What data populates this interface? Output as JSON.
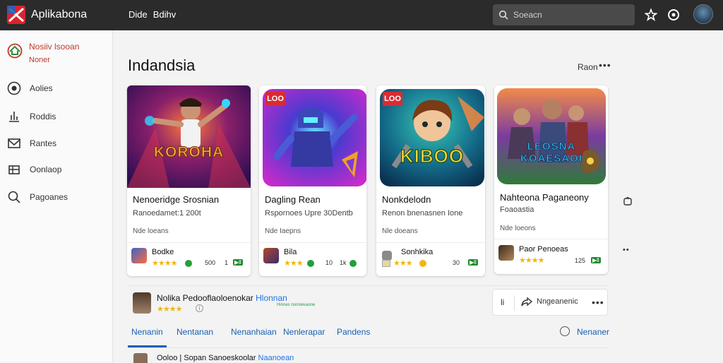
{
  "app": {
    "title": "Aplikabona",
    "menu": [
      "Dide",
      "Bdihv"
    ]
  },
  "search": {
    "placeholder": "Soeacn"
  },
  "sidebar": {
    "profile": {
      "name": "Nosiiv lsooan",
      "sub": "Noner"
    },
    "items": [
      {
        "label": "Aolies",
        "icon": "globe-icon"
      },
      {
        "label": "Roddis",
        "icon": "chart-icon"
      },
      {
        "label": "Rantes",
        "icon": "envelope-icon"
      },
      {
        "label": "Oonlaop",
        "icon": "grid-icon"
      },
      {
        "label": "Pagoanes",
        "icon": "search-icon"
      }
    ]
  },
  "main": {
    "title": "Indandsia",
    "more": "Raon",
    "cards": [
      {
        "title": "Nenoeridge Srosnian",
        "sub": "Ranoedamet:1 200t",
        "tag": "Nde loeans",
        "badge": "",
        "art": "KOROHA",
        "dev": "Bodke",
        "stat": "500",
        "rating": "1"
      },
      {
        "title": "Dagling Rean",
        "sub": "Rspornoes Upre 30Dentb",
        "tag": "Nde Iaepns",
        "badge": "LOO",
        "art": "",
        "dev": "Bila",
        "stat": "10",
        "rating": "1k"
      },
      {
        "title": "Nonkdelodn",
        "sub": "Renon bnenasnen Ione",
        "tag": "Nle doeans",
        "badge": "LOO",
        "art": "KIBOO",
        "dev": "Sonhkika",
        "stat": "30",
        "rating": ""
      },
      {
        "title": "Nahteona Paganeony",
        "sub": "Foaoastia",
        "tag": "Nde loeons",
        "badge": "",
        "art": "LEOSNA KOAESAOI",
        "dev": "Paor Penoeas",
        "stat": "125",
        "rating": ""
      }
    ],
    "featured": {
      "title": "Nolika Pedooflaoloenokar",
      "accent": "Hlonnan",
      "sub": "Hinnes nonslevaone",
      "b1": "li",
      "b2": "Nngeanenic"
    },
    "tabs": [
      "Nenanin",
      "Nentanan",
      "Nenanhaian",
      "Nenlerapar",
      "Pandens"
    ],
    "tab_right": "Nenaner",
    "row3": {
      "text": "Ooloo | Sopan Sanoeskoolar",
      "accent": "Naanoean"
    }
  },
  "colors": {
    "topbar": "#2b2b2b",
    "accent_red": "#c0392b",
    "link_blue": "#1a5fb4",
    "star": "#f1b60f"
  }
}
